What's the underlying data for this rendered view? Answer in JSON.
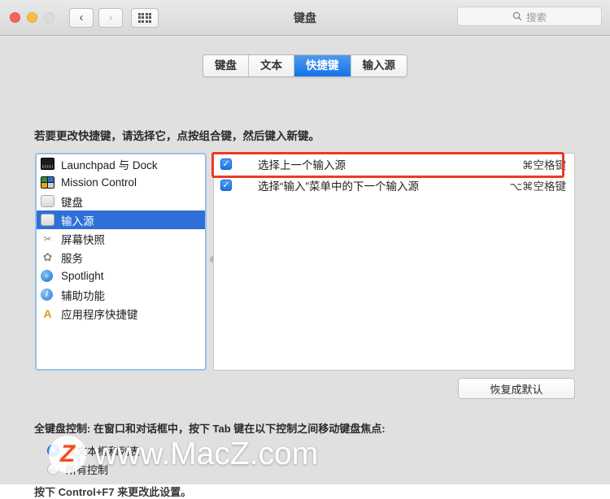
{
  "window": {
    "title": "键盘",
    "traffic_lights": [
      "close",
      "minimize",
      "zoom"
    ],
    "nav": {
      "back": "‹",
      "forward": "›",
      "show_all": "grid-icon"
    }
  },
  "search": {
    "placeholder": "搜索",
    "value": "",
    "icon": "search-icon"
  },
  "tabs": [
    {
      "label": "键盘",
      "active": false
    },
    {
      "label": "文本",
      "active": false
    },
    {
      "label": "快捷键",
      "active": true
    },
    {
      "label": "输入源",
      "active": false
    }
  ],
  "hint": "若要更改快捷键，请选择它，点按组合键，然后键入新键。",
  "sidebar": {
    "items": [
      {
        "label": "Launchpad 与 Dock",
        "icon": "dock-icon",
        "selected": false
      },
      {
        "label": "Mission Control",
        "icon": "mission-control-icon",
        "selected": false
      },
      {
        "label": "键盘",
        "icon": "keyboard-icon",
        "selected": false
      },
      {
        "label": "输入源",
        "icon": "keyboard-icon",
        "selected": true
      },
      {
        "label": "屏幕快照",
        "icon": "screenshot-icon",
        "selected": false
      },
      {
        "label": "服务",
        "icon": "gear-icon",
        "selected": false
      },
      {
        "label": "Spotlight",
        "icon": "spotlight-icon",
        "selected": false
      },
      {
        "label": "辅助功能",
        "icon": "accessibility-icon",
        "selected": false
      },
      {
        "label": "应用程序快捷键",
        "icon": "app-shortcuts-icon",
        "selected": false
      }
    ]
  },
  "shortcuts": {
    "rows": [
      {
        "checked": true,
        "title": "选择上一个输入源",
        "key": "⌘空格键",
        "highlighted": true
      },
      {
        "checked": true,
        "title": "选择“输入”菜单中的下一个输入源",
        "key": "⌥⌘空格键",
        "highlighted": false
      }
    ],
    "highlight_color": "#ee3a24"
  },
  "restore_button": {
    "label": "恢复成默认"
  },
  "full_keyboard_access": {
    "heading": "全键盘控制: 在窗口和对话框中，按下 Tab 键在以下控制之间移动键盘焦点:",
    "options": [
      {
        "label": "仅文本框和列表",
        "selected": true
      },
      {
        "label": "所有控制",
        "selected": false
      }
    ],
    "footnote": "按下 Control+F7 来更改此设置。"
  },
  "watermark": {
    "badge": "Z",
    "text": "www.MacZ.com"
  },
  "colors": {
    "accent_blue": "#2f70d8",
    "tab_active": "#1572e8",
    "highlight_red": "#ee3a24",
    "window_bg": "#e0e0e0"
  }
}
